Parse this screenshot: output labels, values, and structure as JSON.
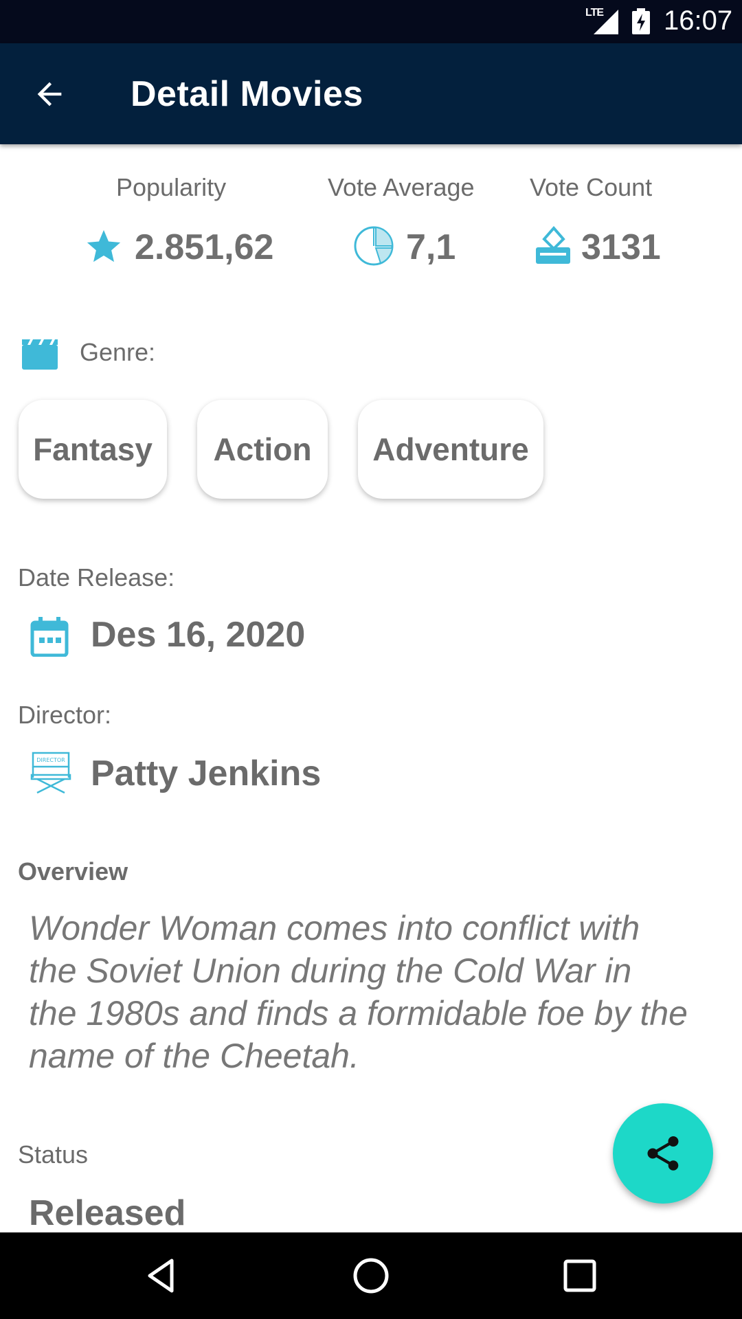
{
  "status_bar": {
    "network": "LTE",
    "time": "16:07"
  },
  "app_bar": {
    "title": "Detail Movies"
  },
  "stats": {
    "popularity": {
      "label": "Popularity",
      "value": "2.851,62"
    },
    "vote_average": {
      "label": "Vote Average",
      "value": "7,1"
    },
    "vote_count": {
      "label": "Vote Count",
      "value": "3131"
    }
  },
  "genre": {
    "label": "Genre:",
    "items": [
      "Fantasy",
      "Action",
      "Adventure"
    ]
  },
  "release": {
    "label": "Date Release:",
    "value": "Des 16, 2020"
  },
  "director": {
    "label": "Director:",
    "value": "Patty Jenkins",
    "icon_text": "DIRECTOR"
  },
  "overview": {
    "label": "Overview",
    "text": "Wonder Woman comes into conflict with the Soviet Union during the Cold War in the 1980s and finds a formidable foe by the name of the Cheetah."
  },
  "status": {
    "label": "Status",
    "value": "Released"
  },
  "colors": {
    "accent": "#3fb9d8",
    "app_bar": "#03203d",
    "fab": "#1dd8c8"
  }
}
